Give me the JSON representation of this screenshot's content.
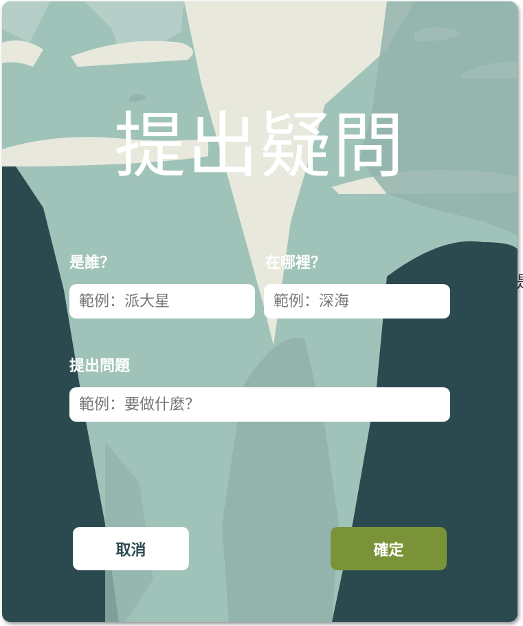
{
  "edge_text": "是",
  "dialog": {
    "title": "提出疑問",
    "fields": {
      "who": {
        "label": "是誰？",
        "placeholder": "範例：派大星"
      },
      "where": {
        "label": "在哪裡？",
        "placeholder": "範例：深海"
      },
      "question": {
        "label": "提出問題",
        "placeholder": "範例：要做什麼？"
      }
    },
    "buttons": {
      "cancel": "取消",
      "confirm": "確定"
    },
    "colors": {
      "confirm_button": "#7a9339",
      "dark_teal": "#2a4a4f",
      "mid_teal": "#93b4ad",
      "light_teal": "#9fc3b9",
      "cream": "#e8e9dc"
    }
  }
}
